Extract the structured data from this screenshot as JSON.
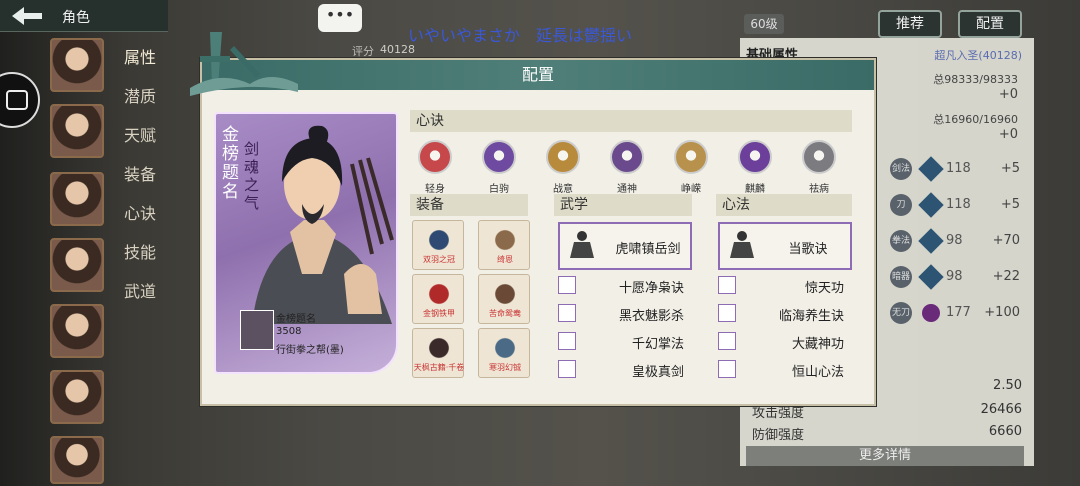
{
  "top_bar": {
    "back_icon": "arrow-left-icon",
    "title": "角色"
  },
  "side_menu": [
    "属性",
    "潜质",
    "天赋",
    "装备",
    "心诀",
    "技能",
    "武道"
  ],
  "chat_bubble": "•••",
  "marquee": "いやいやまさか　延長は鬱揺い",
  "score": {
    "label": "评分",
    "value": "40128"
  },
  "level_badge": "60级",
  "top_buttons": {
    "recommend": "推荐",
    "config": "配置"
  },
  "bg_panel": {
    "base_attr_label": "基础属性",
    "realm": "超凡入圣(40128)",
    "total1": "总98333/98333",
    "plus1": "+0",
    "total2": "总16960/16960",
    "plus2": "+0",
    "stats": [
      {
        "icon": "剑法",
        "value": "118",
        "plus": "+5"
      },
      {
        "icon": "刀",
        "value": "118",
        "plus": "+5"
      },
      {
        "icon": "拳法",
        "value": "98",
        "plus": "+70"
      },
      {
        "icon": "暗器",
        "value": "98",
        "plus": "+22"
      },
      {
        "icon": "无刀",
        "value": "177",
        "plus": "+100"
      }
    ],
    "extra_value": "2.50",
    "attack_label": "攻击强度",
    "attack_value": "26466",
    "defense_label": "防御强度",
    "defense_value": "6660",
    "more_details": "更多详情"
  },
  "modal": {
    "title": "配置",
    "card": {
      "title": "金榜题名",
      "subtitle": "剑魂之气",
      "name": "金榜题名",
      "score": "3508",
      "guild": "行街拳之帮(墨)"
    },
    "xinjue": {
      "header": "心诀",
      "skills": [
        {
          "label": "轻身",
          "color": "#c7484a"
        },
        {
          "label": "白驹",
          "color": "#6e4aa0"
        },
        {
          "label": "战意",
          "color": "#b88a3c"
        },
        {
          "label": "通神",
          "color": "#6a4a8c"
        },
        {
          "label": "峥嵘",
          "color": "#b8914c"
        },
        {
          "label": "麒麟",
          "color": "#6b3f9a"
        },
        {
          "label": "祛病",
          "color": "#7b7b80"
        }
      ]
    },
    "equipment": {
      "header": "装备",
      "items": [
        "双羽之冠",
        "绮恩",
        "金钢铁甲",
        "苦命鸳鸯",
        "天枫古籍·千卷",
        "寒羽幻铖"
      ]
    },
    "wuxue": {
      "header": "武学",
      "main": "虎啸镇岳剑",
      "list": [
        "十愿净枭诀",
        "黑衣魅影杀",
        "千幻掌法",
        "皇极真剑"
      ]
    },
    "xinfa": {
      "header": "心法",
      "main": "当歌诀",
      "list": [
        "惊天功",
        "临海养生诀",
        "大藏神功",
        "恒山心法"
      ]
    }
  }
}
